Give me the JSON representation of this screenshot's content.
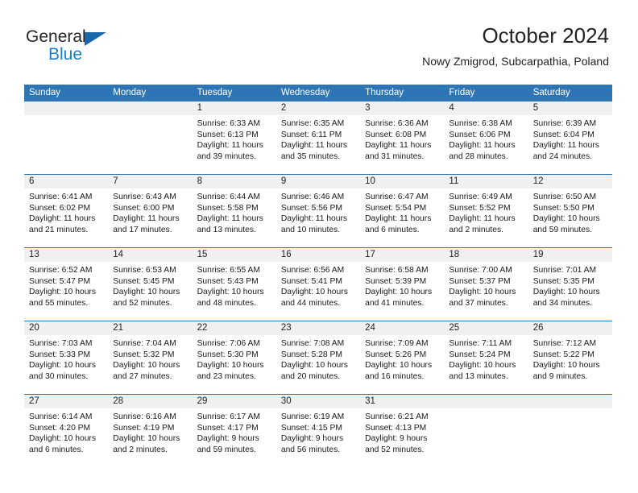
{
  "logo": {
    "word_top": "General",
    "word_bottom": "Blue",
    "accent_color": "#1868ab",
    "text_color": "#262626"
  },
  "header": {
    "title": "October 2024",
    "subtitle": "Nowy Zmigrod, Subcarpathia, Poland",
    "header_bg": "#2e75b6",
    "daynum_bg": "#f0f0f0"
  },
  "weekdays": [
    "Sunday",
    "Monday",
    "Tuesday",
    "Wednesday",
    "Thursday",
    "Friday",
    "Saturday"
  ],
  "labels": {
    "sunrise_prefix": "Sunrise:",
    "sunset_prefix": "Sunset:",
    "daylight_prefix": "Daylight:"
  },
  "weeks": [
    [
      {
        "day": "",
        "sunrise": "",
        "sunset": "",
        "daylight_1": "",
        "daylight_2": ""
      },
      {
        "day": "",
        "sunrise": "",
        "sunset": "",
        "daylight_1": "",
        "daylight_2": ""
      },
      {
        "day": "1",
        "sunrise": "Sunrise: 6:33 AM",
        "sunset": "Sunset: 6:13 PM",
        "daylight_1": "Daylight: 11 hours",
        "daylight_2": "and 39 minutes."
      },
      {
        "day": "2",
        "sunrise": "Sunrise: 6:35 AM",
        "sunset": "Sunset: 6:11 PM",
        "daylight_1": "Daylight: 11 hours",
        "daylight_2": "and 35 minutes."
      },
      {
        "day": "3",
        "sunrise": "Sunrise: 6:36 AM",
        "sunset": "Sunset: 6:08 PM",
        "daylight_1": "Daylight: 11 hours",
        "daylight_2": "and 31 minutes."
      },
      {
        "day": "4",
        "sunrise": "Sunrise: 6:38 AM",
        "sunset": "Sunset: 6:06 PM",
        "daylight_1": "Daylight: 11 hours",
        "daylight_2": "and 28 minutes."
      },
      {
        "day": "5",
        "sunrise": "Sunrise: 6:39 AM",
        "sunset": "Sunset: 6:04 PM",
        "daylight_1": "Daylight: 11 hours",
        "daylight_2": "and 24 minutes."
      }
    ],
    [
      {
        "day": "6",
        "sunrise": "Sunrise: 6:41 AM",
        "sunset": "Sunset: 6:02 PM",
        "daylight_1": "Daylight: 11 hours",
        "daylight_2": "and 21 minutes."
      },
      {
        "day": "7",
        "sunrise": "Sunrise: 6:43 AM",
        "sunset": "Sunset: 6:00 PM",
        "daylight_1": "Daylight: 11 hours",
        "daylight_2": "and 17 minutes."
      },
      {
        "day": "8",
        "sunrise": "Sunrise: 6:44 AM",
        "sunset": "Sunset: 5:58 PM",
        "daylight_1": "Daylight: 11 hours",
        "daylight_2": "and 13 minutes."
      },
      {
        "day": "9",
        "sunrise": "Sunrise: 6:46 AM",
        "sunset": "Sunset: 5:56 PM",
        "daylight_1": "Daylight: 11 hours",
        "daylight_2": "and 10 minutes."
      },
      {
        "day": "10",
        "sunrise": "Sunrise: 6:47 AM",
        "sunset": "Sunset: 5:54 PM",
        "daylight_1": "Daylight: 11 hours",
        "daylight_2": "and 6 minutes."
      },
      {
        "day": "11",
        "sunrise": "Sunrise: 6:49 AM",
        "sunset": "Sunset: 5:52 PM",
        "daylight_1": "Daylight: 11 hours",
        "daylight_2": "and 2 minutes."
      },
      {
        "day": "12",
        "sunrise": "Sunrise: 6:50 AM",
        "sunset": "Sunset: 5:50 PM",
        "daylight_1": "Daylight: 10 hours",
        "daylight_2": "and 59 minutes."
      }
    ],
    [
      {
        "day": "13",
        "sunrise": "Sunrise: 6:52 AM",
        "sunset": "Sunset: 5:47 PM",
        "daylight_1": "Daylight: 10 hours",
        "daylight_2": "and 55 minutes."
      },
      {
        "day": "14",
        "sunrise": "Sunrise: 6:53 AM",
        "sunset": "Sunset: 5:45 PM",
        "daylight_1": "Daylight: 10 hours",
        "daylight_2": "and 52 minutes."
      },
      {
        "day": "15",
        "sunrise": "Sunrise: 6:55 AM",
        "sunset": "Sunset: 5:43 PM",
        "daylight_1": "Daylight: 10 hours",
        "daylight_2": "and 48 minutes."
      },
      {
        "day": "16",
        "sunrise": "Sunrise: 6:56 AM",
        "sunset": "Sunset: 5:41 PM",
        "daylight_1": "Daylight: 10 hours",
        "daylight_2": "and 44 minutes."
      },
      {
        "day": "17",
        "sunrise": "Sunrise: 6:58 AM",
        "sunset": "Sunset: 5:39 PM",
        "daylight_1": "Daylight: 10 hours",
        "daylight_2": "and 41 minutes."
      },
      {
        "day": "18",
        "sunrise": "Sunrise: 7:00 AM",
        "sunset": "Sunset: 5:37 PM",
        "daylight_1": "Daylight: 10 hours",
        "daylight_2": "and 37 minutes."
      },
      {
        "day": "19",
        "sunrise": "Sunrise: 7:01 AM",
        "sunset": "Sunset: 5:35 PM",
        "daylight_1": "Daylight: 10 hours",
        "daylight_2": "and 34 minutes."
      }
    ],
    [
      {
        "day": "20",
        "sunrise": "Sunrise: 7:03 AM",
        "sunset": "Sunset: 5:33 PM",
        "daylight_1": "Daylight: 10 hours",
        "daylight_2": "and 30 minutes."
      },
      {
        "day": "21",
        "sunrise": "Sunrise: 7:04 AM",
        "sunset": "Sunset: 5:32 PM",
        "daylight_1": "Daylight: 10 hours",
        "daylight_2": "and 27 minutes."
      },
      {
        "day": "22",
        "sunrise": "Sunrise: 7:06 AM",
        "sunset": "Sunset: 5:30 PM",
        "daylight_1": "Daylight: 10 hours",
        "daylight_2": "and 23 minutes."
      },
      {
        "day": "23",
        "sunrise": "Sunrise: 7:08 AM",
        "sunset": "Sunset: 5:28 PM",
        "daylight_1": "Daylight: 10 hours",
        "daylight_2": "and 20 minutes."
      },
      {
        "day": "24",
        "sunrise": "Sunrise: 7:09 AM",
        "sunset": "Sunset: 5:26 PM",
        "daylight_1": "Daylight: 10 hours",
        "daylight_2": "and 16 minutes."
      },
      {
        "day": "25",
        "sunrise": "Sunrise: 7:11 AM",
        "sunset": "Sunset: 5:24 PM",
        "daylight_1": "Daylight: 10 hours",
        "daylight_2": "and 13 minutes."
      },
      {
        "day": "26",
        "sunrise": "Sunrise: 7:12 AM",
        "sunset": "Sunset: 5:22 PM",
        "daylight_1": "Daylight: 10 hours",
        "daylight_2": "and 9 minutes."
      }
    ],
    [
      {
        "day": "27",
        "sunrise": "Sunrise: 6:14 AM",
        "sunset": "Sunset: 4:20 PM",
        "daylight_1": "Daylight: 10 hours",
        "daylight_2": "and 6 minutes."
      },
      {
        "day": "28",
        "sunrise": "Sunrise: 6:16 AM",
        "sunset": "Sunset: 4:19 PM",
        "daylight_1": "Daylight: 10 hours",
        "daylight_2": "and 2 minutes."
      },
      {
        "day": "29",
        "sunrise": "Sunrise: 6:17 AM",
        "sunset": "Sunset: 4:17 PM",
        "daylight_1": "Daylight: 9 hours",
        "daylight_2": "and 59 minutes."
      },
      {
        "day": "30",
        "sunrise": "Sunrise: 6:19 AM",
        "sunset": "Sunset: 4:15 PM",
        "daylight_1": "Daylight: 9 hours",
        "daylight_2": "and 56 minutes."
      },
      {
        "day": "31",
        "sunrise": "Sunrise: 6:21 AM",
        "sunset": "Sunset: 4:13 PM",
        "daylight_1": "Daylight: 9 hours",
        "daylight_2": "and 52 minutes."
      },
      {
        "day": "",
        "sunrise": "",
        "sunset": "",
        "daylight_1": "",
        "daylight_2": ""
      },
      {
        "day": "",
        "sunrise": "",
        "sunset": "",
        "daylight_1": "",
        "daylight_2": ""
      }
    ]
  ]
}
